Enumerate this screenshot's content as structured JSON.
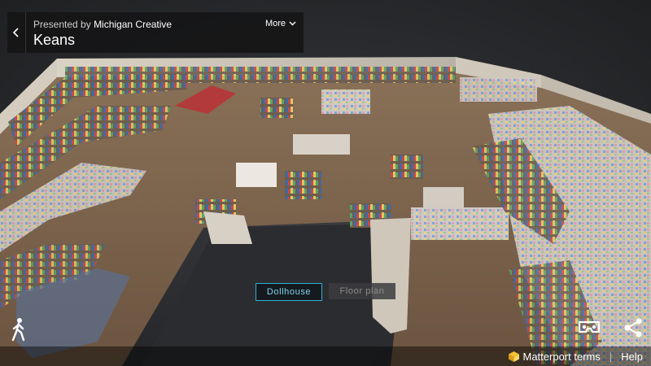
{
  "header": {
    "presented_by_prefix": "Presented by",
    "presenter": "Michigan Creative",
    "title": "Keans",
    "more_label": "More"
  },
  "view_modes": {
    "dollhouse": "Dollhouse",
    "floor_plan": "Floor plan",
    "active": "Dollhouse"
  },
  "footer": {
    "terms": "Matterport terms",
    "help": "Help"
  },
  "icons": {
    "back": "chevron-left-icon",
    "more": "chevron-down-icon",
    "walk": "walk-person-icon",
    "vr": "vr-headset-icon",
    "share": "share-icon",
    "logo": "matterport-logo-icon"
  },
  "colors": {
    "active_mode_border": "#2fb0d4",
    "active_mode_text": "#7fd4ee",
    "panel_bg": "#141416"
  }
}
